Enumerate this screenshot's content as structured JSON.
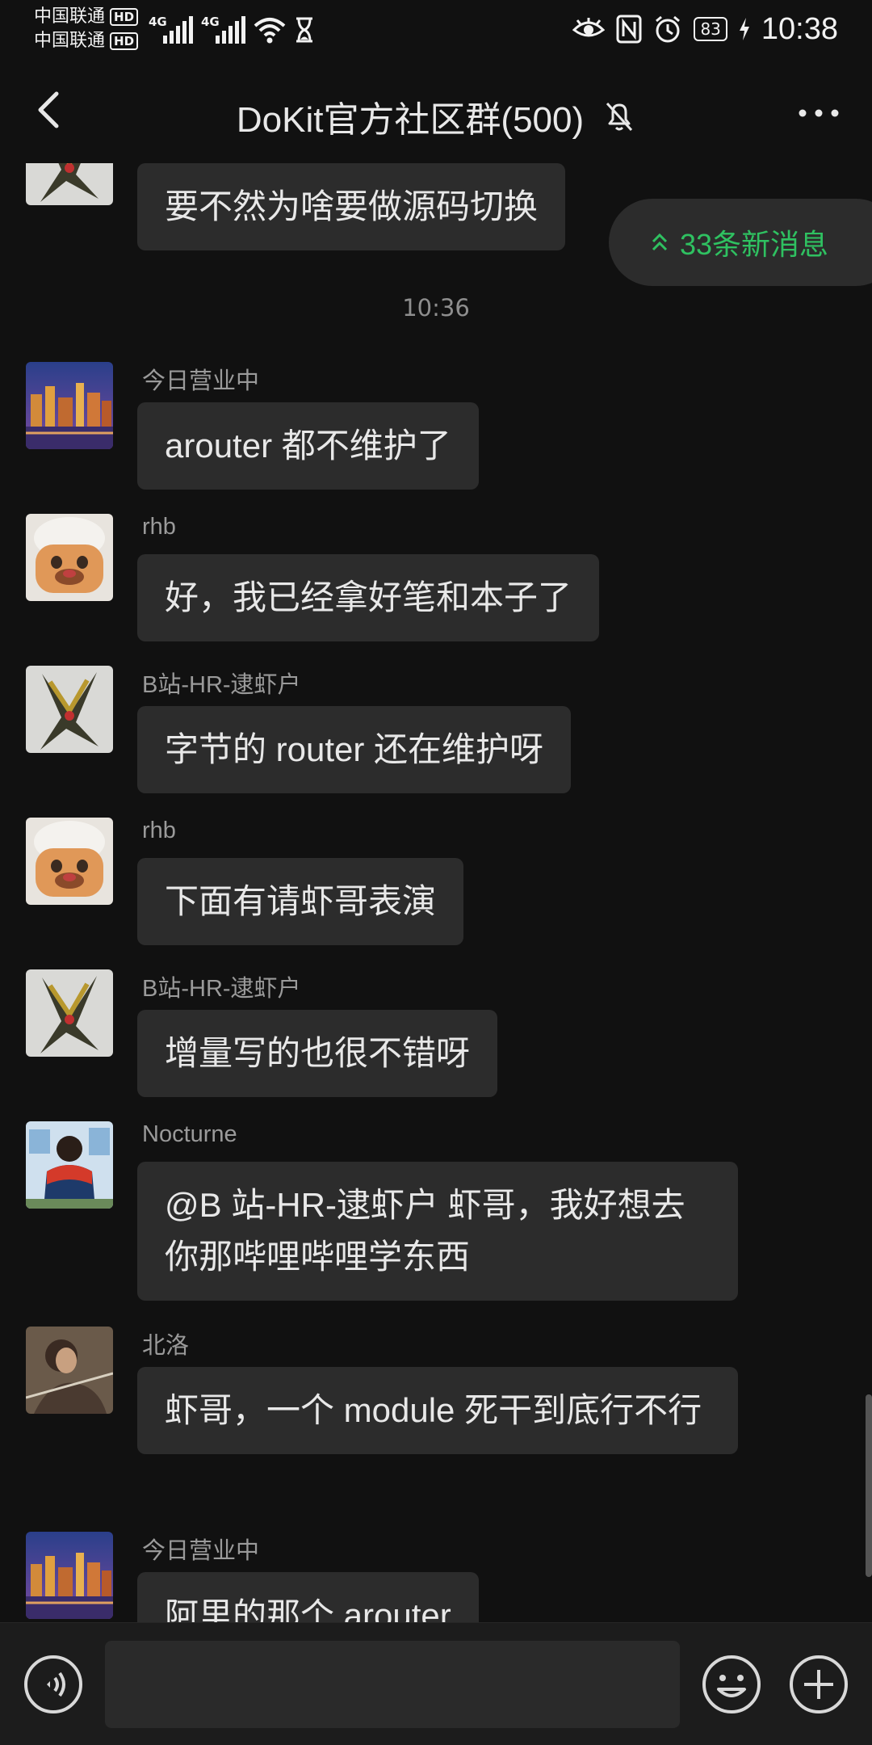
{
  "statusbar": {
    "carrier1": "中国联通",
    "carrier2": "中国联通",
    "hd": "HD",
    "net_type": "4G",
    "battery": "83",
    "time": "10:38"
  },
  "header": {
    "title": "DoKit官方社区群(500)"
  },
  "new_messages": "33条新消息",
  "timestamp": "10:36",
  "messages": [
    {
      "sender": "",
      "text": "要不然为啥要做源码切换"
    },
    {
      "sender": "今日营业中",
      "text": "arouter 都不维护了"
    },
    {
      "sender": "rhb",
      "text": "好，我已经拿好笔和本子了"
    },
    {
      "sender": "B站-HR-逮虾户",
      "text": "字节的 router 还在维护呀"
    },
    {
      "sender": "rhb",
      "text": "下面有请虾哥表演"
    },
    {
      "sender": "B站-HR-逮虾户",
      "text": "增量写的也很不错呀"
    },
    {
      "sender": "Nocturne",
      "text": "@B 站-HR-逮虾户  虾哥，我好想去你那哔哩哔哩学东西"
    },
    {
      "sender": "北洛",
      "text": "虾哥，一个 module 死干到底行不行"
    },
    {
      "sender": "今日营业中",
      "text": "阿里的那个 arouter"
    }
  ],
  "colors": {
    "background": "#111111",
    "bubble": "#2c2c2c",
    "accent_green": "#2fc161"
  }
}
